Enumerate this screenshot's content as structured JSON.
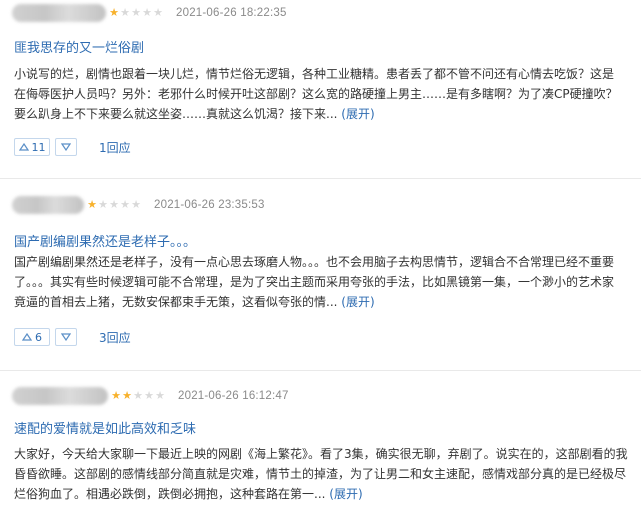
{
  "reviews": [
    {
      "rating_stars": 1,
      "timestamp": "2021-06-26 18:22:35",
      "title": "匪我思存的又一烂俗剧",
      "body_lines": [
        "小说写的烂，剧情也跟着一块儿烂，情节烂俗无逻辑，各种工业糖精。患者丢了都不管不问还有心情去吃饭？这是",
        "在侮辱医护人员吗？另外：老邪什么时候开吐这部剧？这么宽的路硬撞上男主……是有多瞎啊？为了凑CP硬撞吹？",
        "要么趴身上不下来要么就这坐姿……真就这么饥渴？接下来..."
      ],
      "expand_label": "(展开)",
      "upvotes": "11",
      "reply_label": "1回应"
    },
    {
      "rating_stars": 1,
      "timestamp": "2021-06-26 23:35:53",
      "title": "国产剧编剧果然还是老样子。。。",
      "body_lines": [
        "国产剧编剧果然还是老样子，没有一点心思去琢磨人物。。。也不会用脑子去构思情节，逻辑合不合常理已经不重要",
        "了。。。其实有些时候逻辑可能不合常理，是为了突出主题而采用夸张的手法，比如黑镜第一集，一个渺小的艺术家",
        "竟逼的首相去上猪，无数安保都束手无策，这看似夸张的情..."
      ],
      "expand_label": "(展开)",
      "upvotes": "6",
      "reply_label": "3回应"
    },
    {
      "rating_stars": 2,
      "timestamp": "2021-06-26 16:12:47",
      "title": "速配的爱情就是如此高效和乏味",
      "body_lines": [
        "大家好，今天给大家聊一下最近上映的网剧《海上繁花》。看了3集，确实很无聊，弃剧了。说实在的，这部剧看的我",
        "昏昏欲睡。这部剧的感情线部分简直就是灾难，情节土的掉渣，为了让男二和女主速配，感情戏部分真的是已经极尽",
        "烂俗狗血了。相遇必跌倒，跌倒必拥抱，这种套路在第一..."
      ],
      "expand_label": "(展开)"
    }
  ],
  "colors": {
    "link": "#2d6bb1",
    "star_on": "#f7b12c",
    "star_off": "#d9d9d9",
    "divider": "#e9e9e9"
  }
}
